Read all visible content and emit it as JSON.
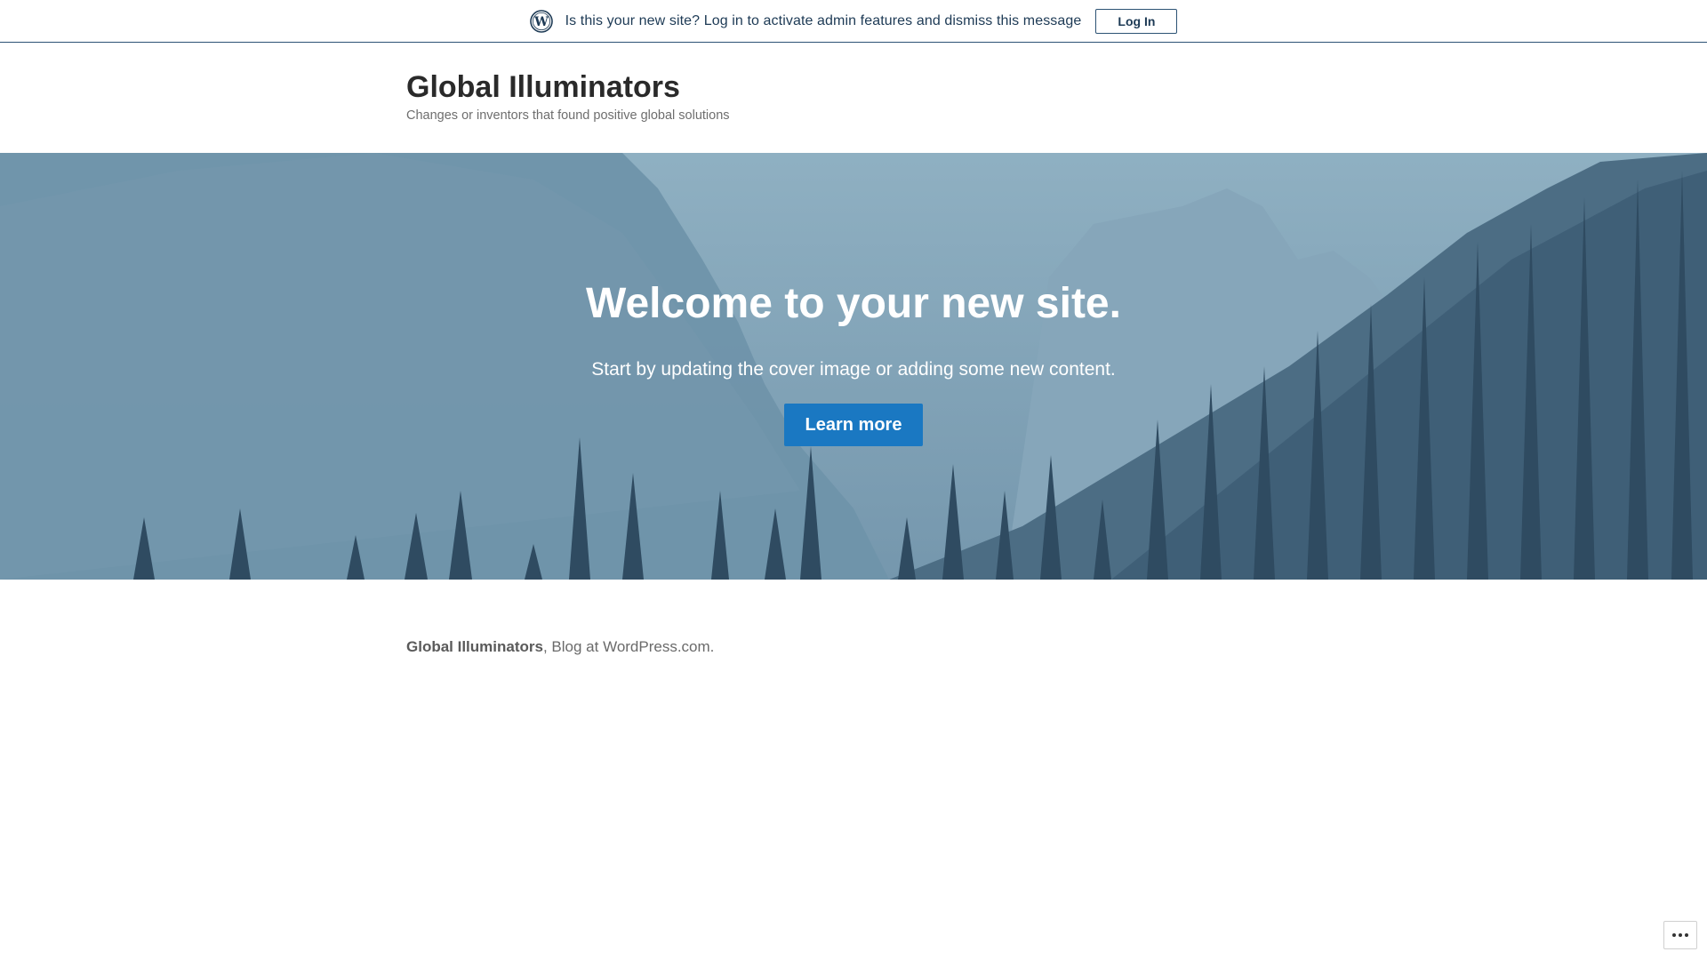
{
  "notice": {
    "icon": "wordpress-logo-icon",
    "message": "Is this your new site? Log in to activate admin features and dismiss this message",
    "login_label": "Log In"
  },
  "header": {
    "title": "Global Illuminators",
    "tagline": "Changes or inventors that found positive global solutions"
  },
  "cover": {
    "heading": "Welcome to your new site.",
    "subtext": "Start by updating the cover image or adding some new content.",
    "button_label": "Learn more",
    "button_color": "#1a78c2"
  },
  "footer": {
    "brand": "Global Illuminators",
    "separator": ",",
    "text": " Blog at WordPress.com."
  },
  "more_button": {
    "icon": "ellipsis-icon"
  }
}
